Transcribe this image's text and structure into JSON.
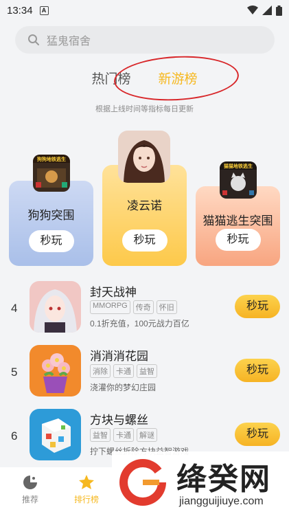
{
  "status": {
    "time": "13:34",
    "a_label": "A"
  },
  "search": {
    "placeholder": "猛鬼宿舍"
  },
  "tabs": [
    {
      "label": "热门榜"
    },
    {
      "label": "新游榜"
    }
  ],
  "subtitle": "根据上线时间等指标每日更新",
  "podium": [
    {
      "name": "狗狗突围",
      "button": "秒玩",
      "icon_caption": "狗狗地铁逃生"
    },
    {
      "name": "凌云诺",
      "button": "秒玩"
    },
    {
      "name": "猫猫逃生突围",
      "button": "秒玩",
      "icon_caption": "猫猫地铁逃生"
    }
  ],
  "list": [
    {
      "rank": "4",
      "title": "封天战神",
      "tags": [
        "MMORPG",
        "传奇",
        "怀旧"
      ],
      "desc": "0.1折充值，100元战力百亿",
      "button": "秒玩"
    },
    {
      "rank": "5",
      "title": "消消消花园",
      "tags": [
        "消除",
        "卡通",
        "益智"
      ],
      "desc": "浇灌你的梦幻庄园",
      "button": "秒玩"
    },
    {
      "rank": "6",
      "title": "方块与螺丝",
      "tags": [
        "益智",
        "卡通",
        "解谜"
      ],
      "desc": "拧下螺丝拆除方块益智游戏",
      "button": "秒玩"
    }
  ],
  "nav": [
    {
      "label": "推荐"
    },
    {
      "label": "排行榜"
    }
  ],
  "watermark": {
    "brand": "绛癸网",
    "url": "jiangguijiuye.com"
  },
  "colors": {
    "accent": "#f6b81f",
    "annotation": "#d8272a"
  }
}
